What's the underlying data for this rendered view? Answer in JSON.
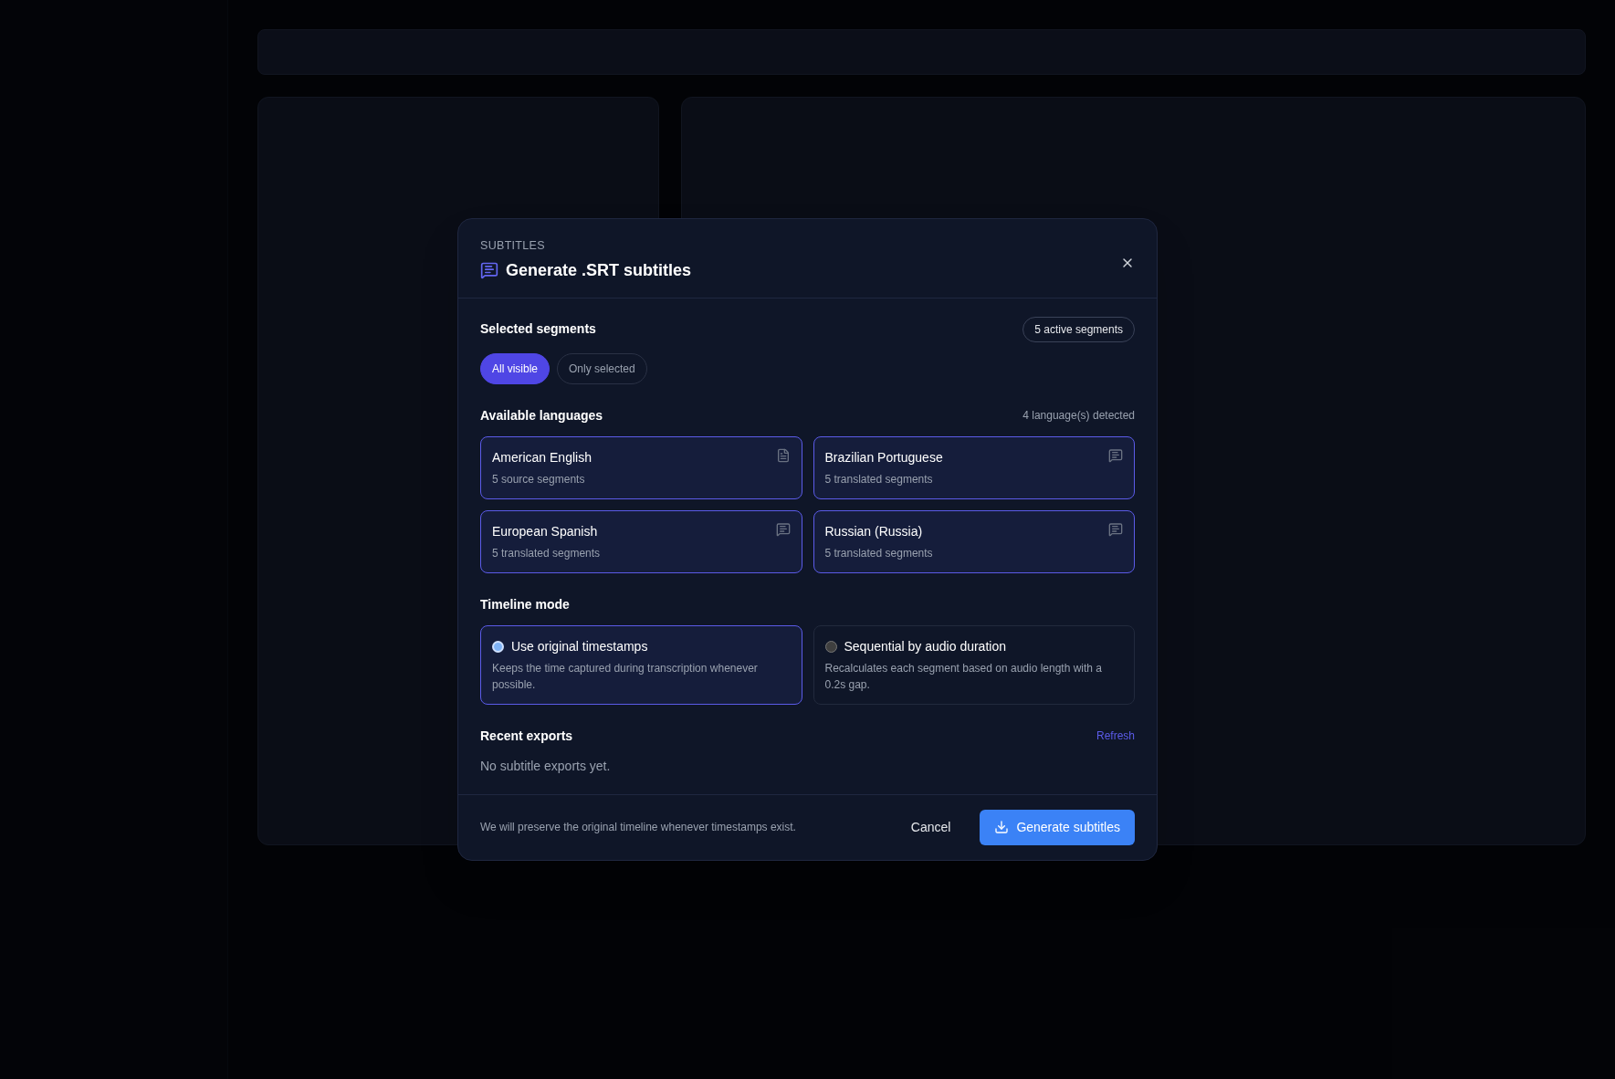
{
  "dialog": {
    "eyebrow": "SUBTITLES",
    "title": "Generate .SRT subtitles",
    "segments": {
      "heading": "Selected segments",
      "count_badge": "5 active segments",
      "filters": [
        {
          "label": "All visible",
          "selected": true
        },
        {
          "label": "Only selected",
          "selected": false
        }
      ]
    },
    "languages": {
      "heading": "Available languages",
      "summary": "4 language(s) detected",
      "items": [
        {
          "name": "American English",
          "detail": "5 source segments",
          "kind": "source",
          "selected": true
        },
        {
          "name": "Brazilian Portuguese",
          "detail": "5 translated segments",
          "kind": "translated",
          "selected": true
        },
        {
          "name": "European Spanish",
          "detail": "5 translated segments",
          "kind": "translated",
          "selected": true
        },
        {
          "name": "Russian (Russia)",
          "detail": "5 translated segments",
          "kind": "translated",
          "selected": true
        }
      ]
    },
    "timeline": {
      "heading": "Timeline mode",
      "options": [
        {
          "label": "Use original timestamps",
          "description": "Keeps the time captured during transcription whenever possible.",
          "selected": true
        },
        {
          "label": "Sequential by audio duration",
          "description": "Recalculates each segment based on audio length with a 0.2s gap.",
          "selected": false
        }
      ]
    },
    "exports": {
      "heading": "Recent exports",
      "refresh": "Refresh",
      "empty": "No subtitle exports yet."
    },
    "footer": {
      "note": "We will preserve the original timeline whenever timestamps exist.",
      "cancel": "Cancel",
      "confirm": "Generate subtitles"
    }
  }
}
